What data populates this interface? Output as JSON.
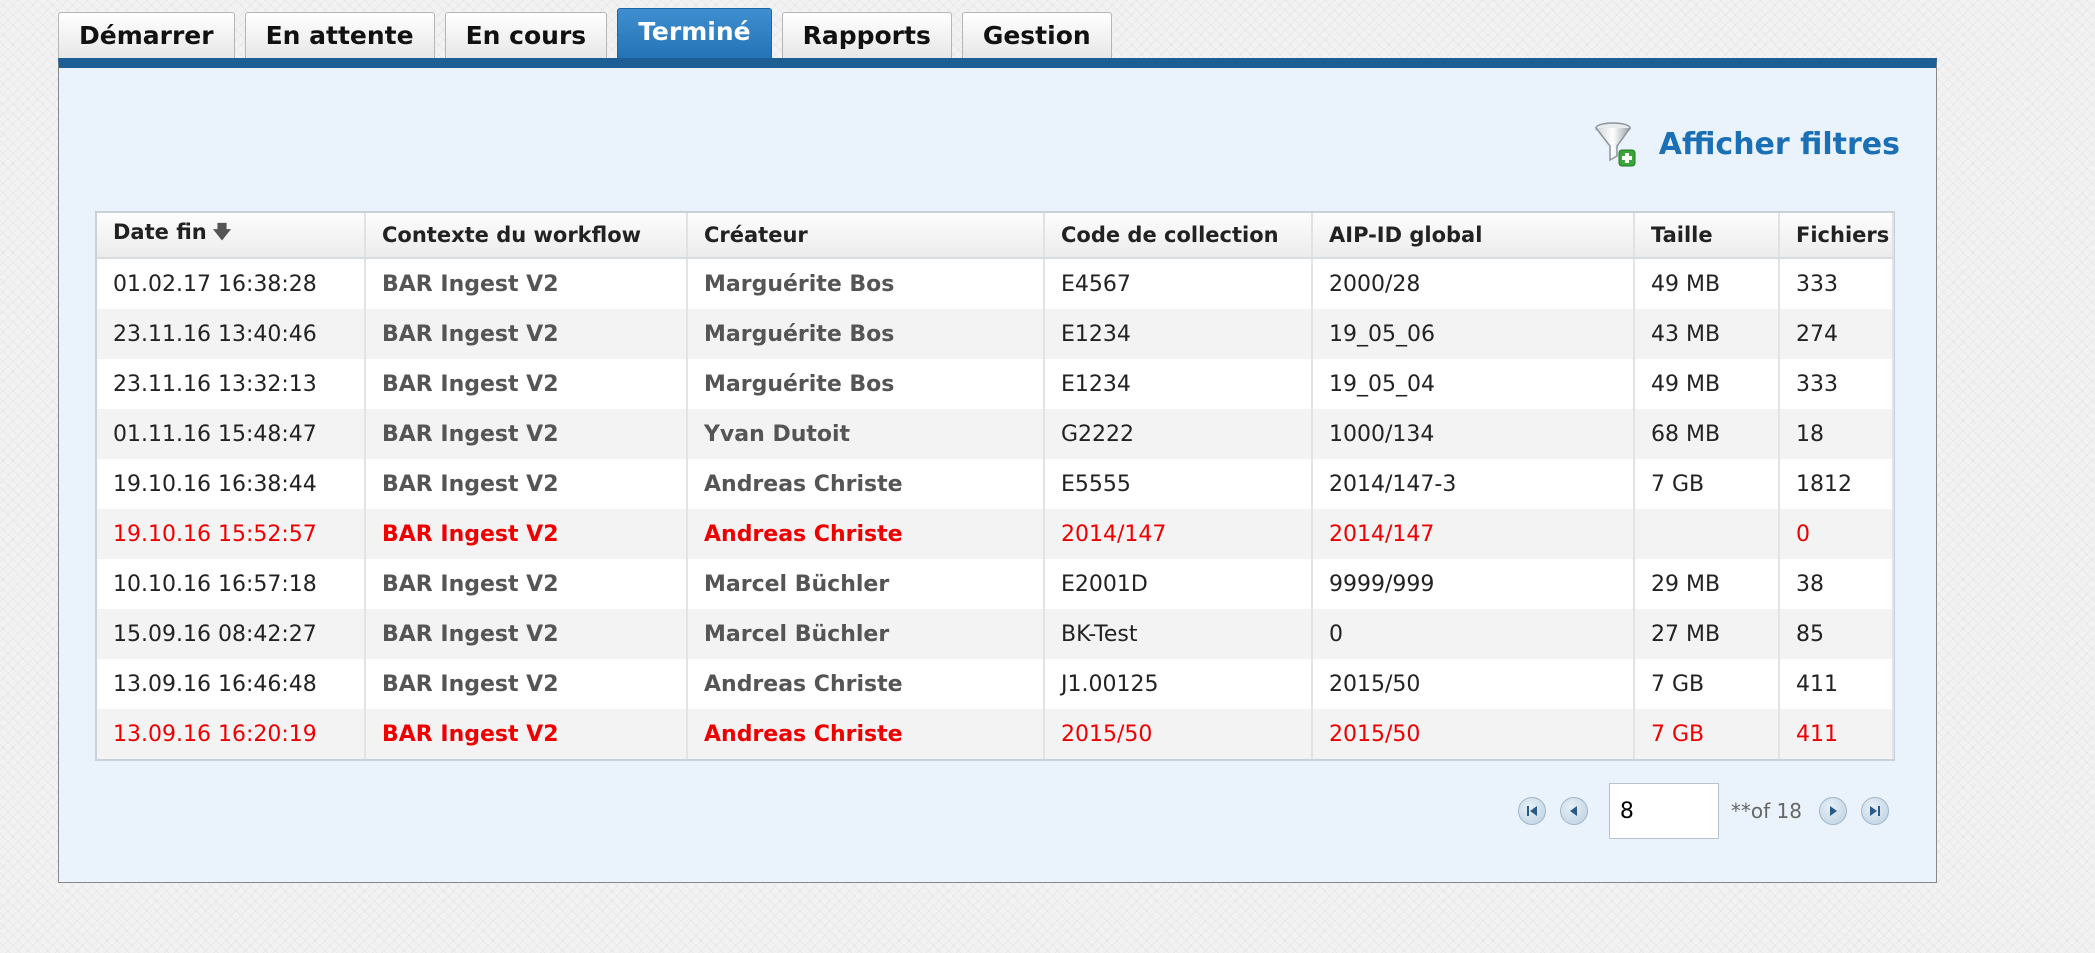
{
  "tabs": [
    {
      "label": "Démarrer",
      "active": false
    },
    {
      "label": "En attente",
      "active": false
    },
    {
      "label": "En cours",
      "active": false
    },
    {
      "label": "Terminé",
      "active": true
    },
    {
      "label": "Rapports",
      "active": false
    },
    {
      "label": "Gestion",
      "active": false
    }
  ],
  "filter": {
    "label": "Afficher filtres",
    "icon": "funnel-add-icon"
  },
  "table": {
    "headers": [
      "Date fin",
      "Contexte du workflow",
      "Créateur",
      "Code de collection",
      "AIP-ID global",
      "Taille",
      "Fichiers"
    ],
    "sort_icon": "sort-down-icon",
    "rows": [
      {
        "date": "01.02.17 16:38:28",
        "context": "BAR Ingest V2",
        "creator": "Marguérite Bos",
        "collection": "E4567",
        "aip": "2000/28",
        "size": "49 MB",
        "files": "333",
        "error": false
      },
      {
        "date": "23.11.16 13:40:46",
        "context": "BAR Ingest V2",
        "creator": "Marguérite Bos",
        "collection": "E1234",
        "aip": "19_05_06",
        "size": "43 MB",
        "files": "274",
        "error": false
      },
      {
        "date": "23.11.16 13:32:13",
        "context": "BAR Ingest V2",
        "creator": "Marguérite Bos",
        "collection": "E1234",
        "aip": "19_05_04",
        "size": "49 MB",
        "files": "333",
        "error": false
      },
      {
        "date": "01.11.16 15:48:47",
        "context": "BAR Ingest V2",
        "creator": "Yvan Dutoit",
        "collection": "G2222",
        "aip": "1000/134",
        "size": "68 MB",
        "files": "18",
        "error": false
      },
      {
        "date": "19.10.16 16:38:44",
        "context": "BAR Ingest V2",
        "creator": "Andreas Christe",
        "collection": "E5555",
        "aip": "2014/147-3",
        "size": "7 GB",
        "files": "1812",
        "error": false
      },
      {
        "date": "19.10.16 15:52:57",
        "context": "BAR Ingest V2",
        "creator": "Andreas Christe",
        "collection": "2014/147",
        "aip": "2014/147",
        "size": "",
        "files": "0",
        "error": true
      },
      {
        "date": "10.10.16 16:57:18",
        "context": "BAR Ingest V2",
        "creator": "Marcel Büchler",
        "collection": "E2001D",
        "aip": "9999/999",
        "size": "29 MB",
        "files": "38",
        "error": false
      },
      {
        "date": "15.09.16 08:42:27",
        "context": "BAR Ingest V2",
        "creator": "Marcel Büchler",
        "collection": "BK-Test",
        "aip": "0",
        "size": "27 MB",
        "files": "85",
        "error": false
      },
      {
        "date": "13.09.16 16:46:48",
        "context": "BAR Ingest V2",
        "creator": "Andreas Christe",
        "collection": "J1.00125",
        "aip": "2015/50",
        "size": "7 GB",
        "files": "411",
        "error": false
      },
      {
        "date": "13.09.16 16:20:19",
        "context": "BAR Ingest V2",
        "creator": "Andreas Christe",
        "collection": "2015/50",
        "aip": "2015/50",
        "size": "7 GB",
        "files": "411",
        "error": true
      }
    ]
  },
  "pager": {
    "current_page": "8",
    "of_label": "**of 18",
    "icons": [
      "first-page-icon",
      "previous-page-icon",
      "next-page-icon",
      "last-page-icon"
    ]
  },
  "colors": {
    "accent": "#1d5f95",
    "tab_active": "#2f80c3",
    "link": "#1a6fb5",
    "error": "#ee0000"
  }
}
